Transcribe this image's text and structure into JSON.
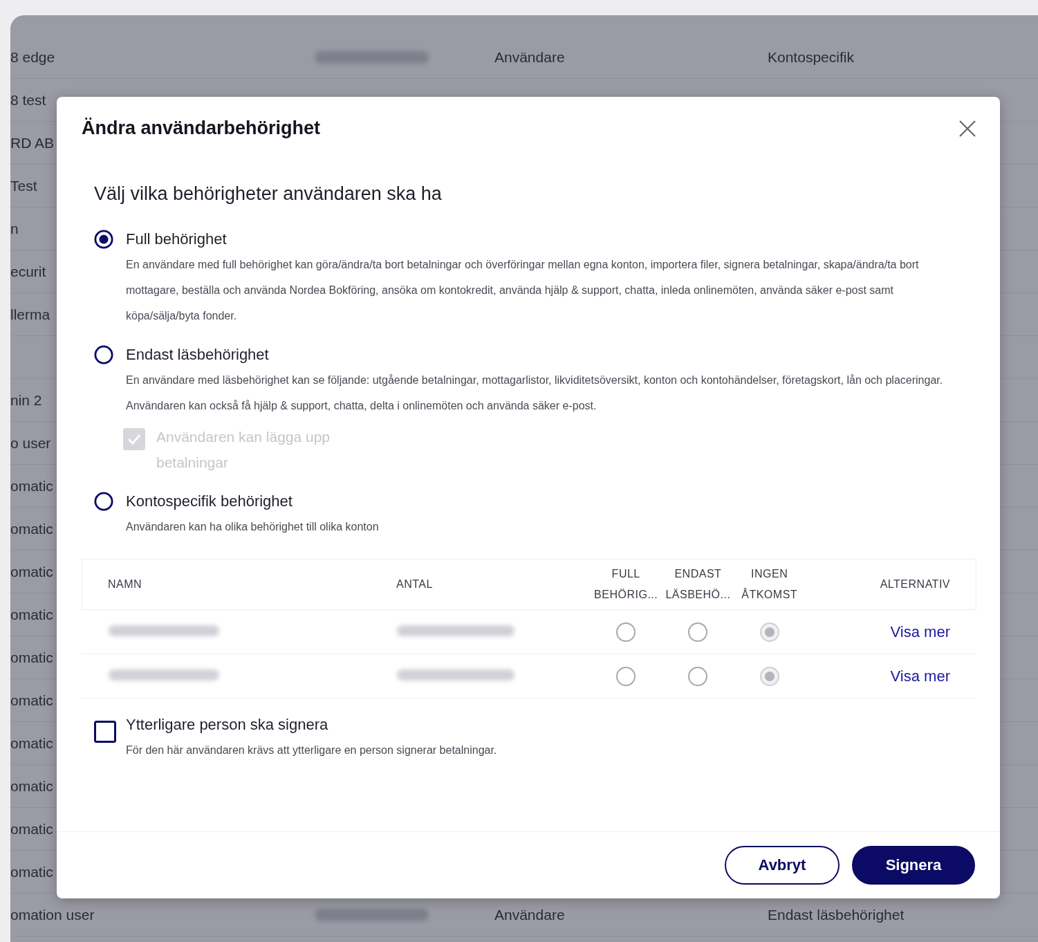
{
  "background_table": {
    "rows": [
      {
        "name": "8 edge",
        "number_redacted": true,
        "type": "Användare",
        "role": "Kontospecifik"
      },
      {
        "name": "8 test"
      },
      {
        "name": "RD AB"
      },
      {
        "name": "Test"
      },
      {
        "name": "n"
      },
      {
        "name": "ecurit"
      },
      {
        "name": "llerma"
      },
      {
        "name": ""
      },
      {
        "name": "nin 2"
      },
      {
        "name": "o user"
      },
      {
        "name": "omatic"
      },
      {
        "name": "omatic"
      },
      {
        "name": "omatic"
      },
      {
        "name": "omatic"
      },
      {
        "name": "omatic"
      },
      {
        "name": "omatic"
      },
      {
        "name": "omatic"
      },
      {
        "name": "omatic"
      },
      {
        "name": "omatic"
      },
      {
        "name": "omatic"
      },
      {
        "name": "omation user",
        "number_redacted": true,
        "type": "Användare",
        "role": "Endast läsbehörighet"
      }
    ]
  },
  "dialog": {
    "title": "Ändra användarbehörighet",
    "heading": "Välj vilka behörigheter användaren ska ha",
    "options": [
      {
        "label": "Full behörighet",
        "selected": true,
        "description": "En användare med full behörighet kan göra/ändra/ta bort betalningar och överföringar mellan egna konton, importera filer, signera betalningar, skapa/ändra/ta bort mottagare, beställa och använda Nordea Bokföring, ansöka om kontokredit, använda hjälp & support, chatta, inleda onlinemöten, använda säker e-post samt köpa/sälja/byta fonder."
      },
      {
        "label": "Endast läsbehörighet",
        "selected": false,
        "description": "En användare med läsbehörighet kan se följande: utgående betalningar, mottagarlistor, likviditetsöversikt, konton och kontohändelser, företagskort, lån och placeringar. Användaren kan också få hjälp & support, chatta, delta i onlinemöten och använda säker e-post.",
        "sub_checkbox": {
          "label": "Användaren kan lägga upp betalningar",
          "checked": true,
          "disabled": true
        }
      },
      {
        "label": "Kontospecifik behörighet",
        "selected": false,
        "description": "Användaren kan ha olika behörighet till olika konton"
      }
    ],
    "table": {
      "columns": [
        "NAMN",
        "ANTAL",
        "FULL BEHÖRIG...",
        "ENDAST LÄSBEHÖ...",
        "INGEN ÅTKOMST",
        "ALTERNATIV"
      ],
      "rows": [
        {
          "choices": [
            {
              "selected": false
            },
            {
              "selected": false
            },
            {
              "selected": true
            }
          ],
          "link": "Visa mer"
        },
        {
          "choices": [
            {
              "selected": false
            },
            {
              "selected": false
            },
            {
              "selected": true
            }
          ],
          "link": "Visa mer"
        }
      ]
    },
    "extra_signer": {
      "label": "Ytterligare person ska signera",
      "checked": false,
      "description": "För den här användaren krävs att ytterligare en person signerar betalningar."
    },
    "buttons": [
      {
        "label": "Avbryt",
        "kind": "secondary"
      },
      {
        "label": "Signera",
        "kind": "primary"
      }
    ]
  }
}
